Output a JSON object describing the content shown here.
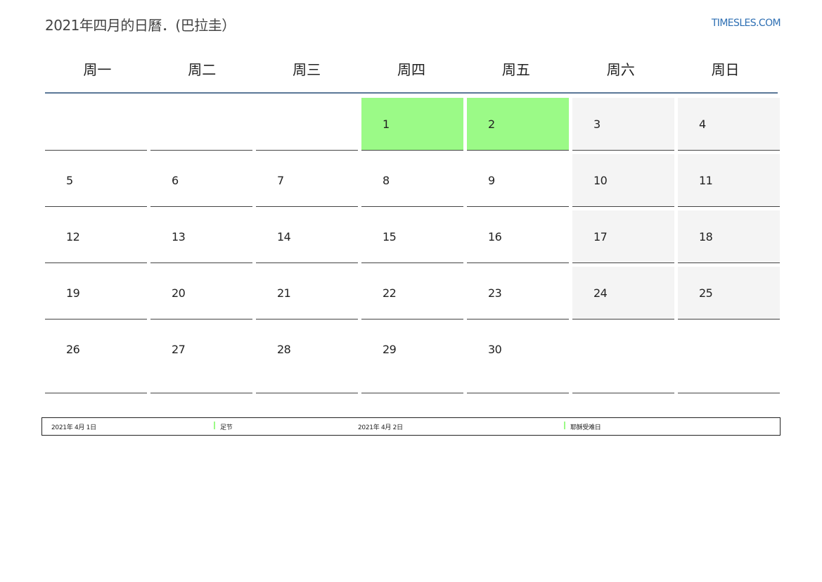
{
  "title": "2021年四月的日曆．(巴拉圭）",
  "site": "TIMESLES.COM",
  "weekdays": [
    "周一",
    "周二",
    "周三",
    "周四",
    "周五",
    "周六",
    "周日"
  ],
  "days": {
    "d1": "1",
    "d2": "2",
    "d3": "3",
    "d4": "4",
    "d5": "5",
    "d6": "6",
    "d7": "7",
    "d8": "8",
    "d9": "9",
    "d10": "10",
    "d11": "11",
    "d12": "12",
    "d13": "13",
    "d14": "14",
    "d15": "15",
    "d16": "16",
    "d17": "17",
    "d18": "18",
    "d19": "19",
    "d20": "20",
    "d21": "21",
    "d22": "22",
    "d23": "23",
    "d24": "24",
    "d25": "25",
    "d26": "26",
    "d27": "27",
    "d28": "28",
    "d29": "29",
    "d30": "30"
  },
  "holidays": [
    {
      "date": "2021年 4月 1日",
      "name": "足节"
    },
    {
      "date": "2021年 4月 2日",
      "name": "耶稣受难日"
    }
  ],
  "colors": {
    "holiday": "#9bfa87",
    "weekend": "#f4f4f4",
    "header_rule": "#5b7898",
    "link": "#2e6fb3"
  }
}
